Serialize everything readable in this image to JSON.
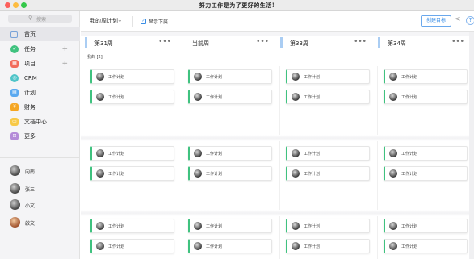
{
  "window": {
    "title": "努力工作是为了更好的生活!"
  },
  "sidebar": {
    "search_placeholder": "搜索",
    "nav": [
      {
        "label": "首页",
        "icon": "home-icon",
        "color": "#7aa3d8",
        "active": true
      },
      {
        "label": "任务",
        "icon": "task-icon",
        "color": "#3fc27f",
        "plus": "+"
      },
      {
        "label": "项目",
        "icon": "project-icon",
        "color": "#f26b5b",
        "plus": "+"
      },
      {
        "label": "CRM",
        "icon": "crm-icon",
        "color": "#4ec4c8"
      },
      {
        "label": "计划",
        "icon": "plan-icon",
        "color": "#5aa9f0"
      },
      {
        "label": "财务",
        "icon": "finance-icon",
        "color": "#f5a623"
      },
      {
        "label": "文档中心",
        "icon": "document-icon",
        "color": "#f7c948"
      },
      {
        "label": "更多",
        "icon": "more-grid-icon",
        "color": "#b48bd8"
      }
    ],
    "members": [
      {
        "name": "向南"
      },
      {
        "name": "张三"
      },
      {
        "name": "小文"
      },
      {
        "name": "啟文"
      }
    ]
  },
  "toolbar": {
    "plan_select": "我的周计划",
    "show_done_label": "显示下属",
    "create_button": "创建目标",
    "help": "?"
  },
  "board": {
    "columns": [
      {
        "label": "第31周"
      },
      {
        "label": "当前周"
      },
      {
        "label": "第33周"
      },
      {
        "label": "第34周"
      }
    ],
    "column_menu": "•••",
    "group_label": "我的 [2]",
    "card_label": "工作计划"
  },
  "colors": {
    "accent": "#3a8ee6",
    "card_bar": "#3fc27f"
  }
}
